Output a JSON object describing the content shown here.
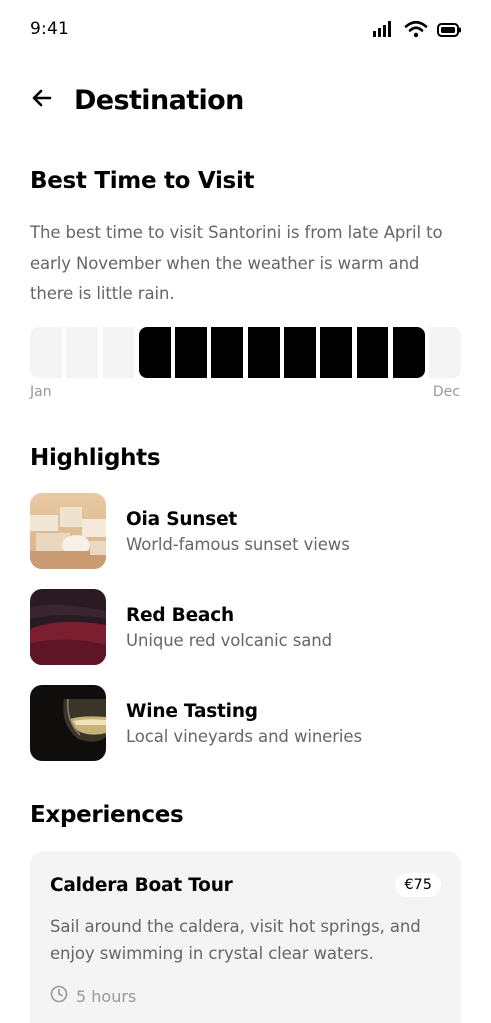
{
  "status_bar": {
    "time": "9:41",
    "icons": [
      "signal-icon",
      "wifi-icon",
      "battery-icon"
    ]
  },
  "header": {
    "back_icon": "arrow-left-icon",
    "title": "Destination"
  },
  "best_time": {
    "title": "Best Time to Visit",
    "description": "The best time to visit Santorini is from late April to early November when the weather is warm and there is little rain.",
    "months_total": 12,
    "active_months": [
      4,
      5,
      6,
      7,
      8,
      9,
      10,
      11
    ],
    "start_label": "Jan",
    "end_label": "Dec",
    "active_color": "#000000",
    "inactive_color": "#f4f4f4"
  },
  "highlights": {
    "title": "Highlights",
    "items": [
      {
        "title": "Oia Sunset",
        "subtitle": "World-famous sunset views"
      },
      {
        "title": "Red Beach",
        "subtitle": "Unique red volcanic sand"
      },
      {
        "title": "Wine Tasting",
        "subtitle": "Local vineyards and wineries"
      }
    ]
  },
  "experiences": {
    "title": "Experiences",
    "items": [
      {
        "title": "Caldera Boat Tour",
        "price": "€75",
        "description": "Sail around the caldera, visit hot springs, and enjoy swimming in crystal clear waters.",
        "duration": "5 hours",
        "duration_icon": "clock-icon"
      }
    ]
  }
}
